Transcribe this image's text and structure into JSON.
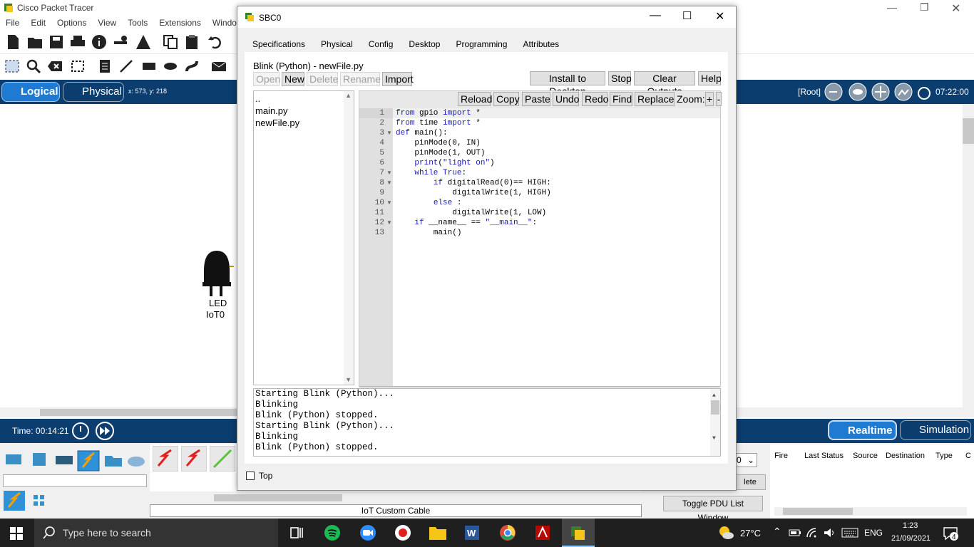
{
  "app": {
    "title": "Cisco Packet Tracer",
    "menu": [
      "File",
      "Edit",
      "Options",
      "View",
      "Tools",
      "Extensions",
      "Window"
    ],
    "help_label": "?"
  },
  "logical_bar": {
    "logical_label": "Logical",
    "physical_label": "Physical",
    "coords": "x: 573, y: 218",
    "root_label": "[Root]",
    "clock": "07:22:00"
  },
  "workspace": {
    "device_name": "LED",
    "device_id": "IoT0"
  },
  "time_bar": {
    "time": "Time: 00:14:21",
    "realtime_label": "Realtime",
    "simulation_label": "Simulation"
  },
  "bottom": {
    "cable_label": "IoT Custom Cable",
    "delete_label": "lete",
    "toggle_pdu": "Toggle PDU List Window",
    "pdu_columns": [
      "Fire",
      "Last Status",
      "Source",
      "Destination",
      "Type",
      "C"
    ],
    "num_field": "0"
  },
  "dialog": {
    "title": "SBC0",
    "tabs": [
      "Specifications",
      "Physical",
      "Config",
      "Desktop",
      "Programming",
      "Attributes"
    ],
    "active_tab": "Programming",
    "project_title": "Blink (Python) - newFile.py",
    "file_buttons": {
      "open": "Open",
      "new": "New",
      "delete": "Delete",
      "rename": "Rename",
      "import": "Import"
    },
    "run_buttons": {
      "install": "Install to Desktop",
      "stop": "Stop",
      "clear": "Clear Outputs",
      "help": "Help"
    },
    "editor_buttons": {
      "reload": "Reload",
      "copy": "Copy",
      "paste": "Paste",
      "undo": "Undo",
      "redo": "Redo",
      "find": "Find",
      "replace": "Replace",
      "zoom": "Zoom:",
      "zoom_in": "+",
      "zoom_out": "-"
    },
    "files": [
      "..",
      "main.py",
      "newFile.py"
    ],
    "code_lines": [
      "from gpio import *",
      "from time import *",
      "def main():",
      "    pinMode(0, IN)",
      "    pinMode(1, OUT)",
      "    print(\"light on\")",
      "    while True:",
      "        if digitalRead(0)== HIGH:",
      "            digitalWrite(1, HIGH)",
      "        else :",
      "            digitalWrite(1, LOW)",
      "    if __name__ == \"__main__\":",
      "        main()"
    ],
    "console_lines": [
      "Starting Blink (Python)...",
      "Blinking",
      "Blink (Python) stopped.",
      "Starting Blink (Python)...",
      "Blinking",
      "Blink (Python) stopped."
    ],
    "top_checkbox": "Top"
  },
  "taskbar": {
    "search_placeholder": "Type here to search",
    "weather": "27°C",
    "lang": "ENG",
    "time": "1:23",
    "date": "21/09/2021",
    "notifications": "4"
  }
}
